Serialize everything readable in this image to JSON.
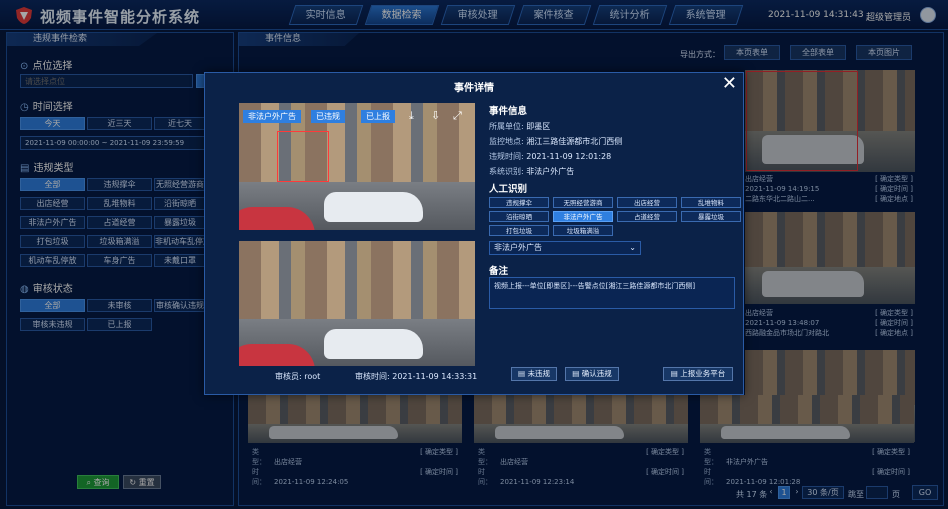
{
  "app": {
    "title": "视频事件智能分析系统",
    "datetime": "2021-11-09 14:31:43",
    "user": "超级管理员"
  },
  "nav": [
    {
      "label": "实时信息"
    },
    {
      "label": "数据检索"
    },
    {
      "label": "审核处理"
    },
    {
      "label": "案件核查"
    },
    {
      "label": "统计分析"
    },
    {
      "label": "系统管理"
    }
  ],
  "colors": {
    "accent": "#2f7fe0",
    "background": "#071a3e",
    "success": "#1e9c3a"
  },
  "left": {
    "header": "违规事件检索",
    "point": {
      "title": "点位选择",
      "placeholder": "请选择点位"
    },
    "time": {
      "title": "时间选择",
      "ranges": [
        "今天",
        "近三天",
        "近七天"
      ],
      "start": "2021-11-09 00:00:00",
      "sep": "~",
      "end": "2021-11-09 23:59:59"
    },
    "type": {
      "title": "违规类型",
      "options": [
        "全部",
        "违规撑伞",
        "无照经营游商",
        "出店经营",
        "乱堆物料",
        "沿街晾晒",
        "非法户外广告",
        "占道经营",
        "暴露垃圾",
        "打包垃圾",
        "垃圾箱满溢",
        "非机动车乱停放",
        "机动车乱停放",
        "车身广告",
        "未戴口罩"
      ]
    },
    "status": {
      "title": "审核状态",
      "options": [
        "全部",
        "未审核",
        "审核确认违规",
        "审核未违规",
        "已上报"
      ]
    },
    "query": "查询",
    "reset": "重置"
  },
  "main": {
    "header": "事件信息",
    "export_label": "导出方式：",
    "export_buttons": [
      "本页表单",
      "全部表单",
      "本页图片"
    ],
    "cards_right": [
      {
        "type": "出店经营",
        "time": "2021-11-09 14:19:15",
        "place": "二路东华北二路山二...",
        "t1": "[ 确定类型 ]",
        "t2": "[ 确定时间 ]",
        "t3": "[ 确定地点 ]"
      },
      {
        "type": "出店经营",
        "time": "2021-11-09 13:48:07",
        "place": "西路融金品市场北门对路北",
        "t1": "[ 确定类型 ]",
        "t2": "[ 确定时间 ]",
        "t3": "[ 确定地点 ]"
      }
    ],
    "cards_bottom": [
      {
        "type": "出店经营",
        "time": "2021-11-09 12:24:05",
        "t1": "[ 确定类型 ]",
        "t2": "[ 确定时间 ]"
      },
      {
        "type": "出店经营",
        "time": "2021-11-09 12:23:14",
        "t1": "[ 确定类型 ]",
        "t2": "[ 确定时间 ]"
      },
      {
        "type": "非法户外广告",
        "time": "2021-11-09 12:01:28",
        "t1": "[ 确定类型 ]",
        "t2": "[ 确定时间 ]"
      }
    ],
    "labels": {
      "type": "类 型：",
      "time": "时 间："
    },
    "pager": {
      "total": "共 17 条",
      "page": "1",
      "per": "30 条/页",
      "goto": "跳至",
      "unit": "页",
      "go": "GO"
    }
  },
  "modal": {
    "title": "事件详情",
    "photo_tags": [
      "非法户外广告",
      "已违规",
      "已上报"
    ],
    "reviewer": "审核员: root",
    "review_time": "审核时间: 2021-11-09 14:33:31",
    "info_title": "事件信息",
    "fields": [
      {
        "k": "所属单位:",
        "v": "即墨区"
      },
      {
        "k": "监控地点:",
        "v": "湘江三路佳源都市北门西侧"
      },
      {
        "k": "违规时间:",
        "v": "2021-11-09 12:01:28"
      },
      {
        "k": "系统识别:",
        "v": "非法户外广告"
      }
    ],
    "manual_title": "人工识别",
    "manual_options": [
      "违规撑伞",
      "无照经营游商",
      "出店经营",
      "乱堆物料",
      "沿街晾晒",
      "非法户外广告",
      "占道经营",
      "暴露垃圾",
      "打包垃圾",
      "垃圾箱满溢"
    ],
    "manual_selected": "非法户外广告",
    "remark_title": "备注",
    "remark_text": "视频上报---单位[即墨区]---告警点位[湘江三路佳源都市北门西侧]",
    "buttons": [
      "未违规",
      "确认违规",
      "上报业务平台"
    ]
  }
}
